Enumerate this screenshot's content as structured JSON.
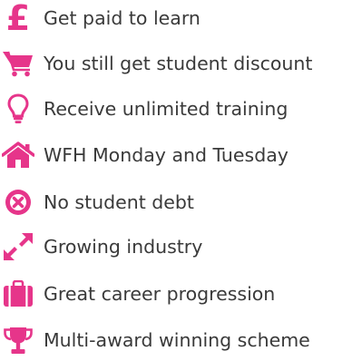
{
  "accent_color": "#e6358a",
  "text_color": "#3a3a3a",
  "items": [
    {
      "icon": "pound-icon",
      "label": "Get paid to learn"
    },
    {
      "icon": "shopping-cart-icon",
      "label": "You still get student discount"
    },
    {
      "icon": "lightbulb-icon",
      "label": "Receive unlimited training"
    },
    {
      "icon": "home-icon",
      "label": "WFH Monday and Tuesday"
    },
    {
      "icon": "times-circle-icon",
      "label": "No student debt"
    },
    {
      "icon": "expand-arrows-icon",
      "label": "Growing industry"
    },
    {
      "icon": "briefcase-icon",
      "label": "Great career progression"
    },
    {
      "icon": "trophy-icon",
      "label": "Multi-award winning scheme"
    }
  ]
}
